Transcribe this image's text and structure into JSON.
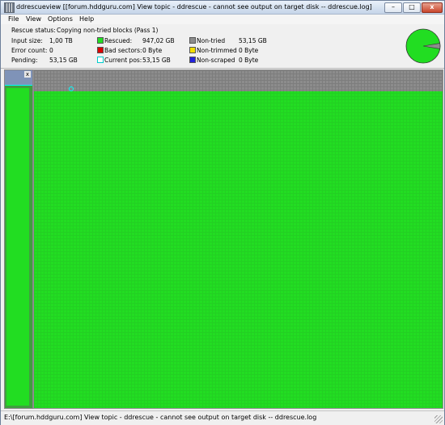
{
  "window": {
    "title": "ddrescueview [[forum.hddguru.com] View topic - ddrescue - cannot see output on target disk -- ddrescue.log]",
    "minimize_label": "–",
    "maximize_label": "□",
    "close_label": "x"
  },
  "menu": [
    "File",
    "View",
    "Options",
    "Help"
  ],
  "status": {
    "rescue_status_label": "Rescue status:",
    "rescue_status_value": "Copying non-tried blocks (Pass 1)",
    "input_size_label": "Input size:",
    "input_size_value": "1,00 TB",
    "error_count_label": "Error count:",
    "error_count_value": "0",
    "pending_label": "Pending:",
    "pending_value": "53,15 GB",
    "rescued_label": "Rescued:",
    "rescued_value": "947,02 GB",
    "bad_sectors_label": "Bad sectors:",
    "bad_sectors_value": "0 Byte",
    "current_pos_label": "Current pos:",
    "current_pos_value": "53,15 GB",
    "non_tried_label": "Non-tried",
    "non_tried_value": "53,15 GB",
    "non_trimmed_label": "Non-trimmed",
    "non_trimmed_value": "0 Byte",
    "non_scraped_label": "Non-scraped",
    "non_scraped_value": "0 Byte"
  },
  "legend_colors": {
    "rescued": "#22dd22",
    "bad_sectors": "#dd0000",
    "current_pos": "#00ffff",
    "non_tried": "#8c8c8c",
    "non_trimmed": "#f2dd00",
    "non_scraped": "#2222dd"
  },
  "pie": {
    "rescued_fraction": 0.947,
    "non_tried_fraction": 0.053
  },
  "block_map": {
    "non_tried_fraction": 0.053,
    "current_pos_icon": "current-position-marker"
  },
  "leftbar": {
    "close_label": "x"
  },
  "statusbar": {
    "text": "E:\\[forum.hddguru.com] View topic - ddrescue - cannot see output on target disk -- ddrescue.log"
  }
}
